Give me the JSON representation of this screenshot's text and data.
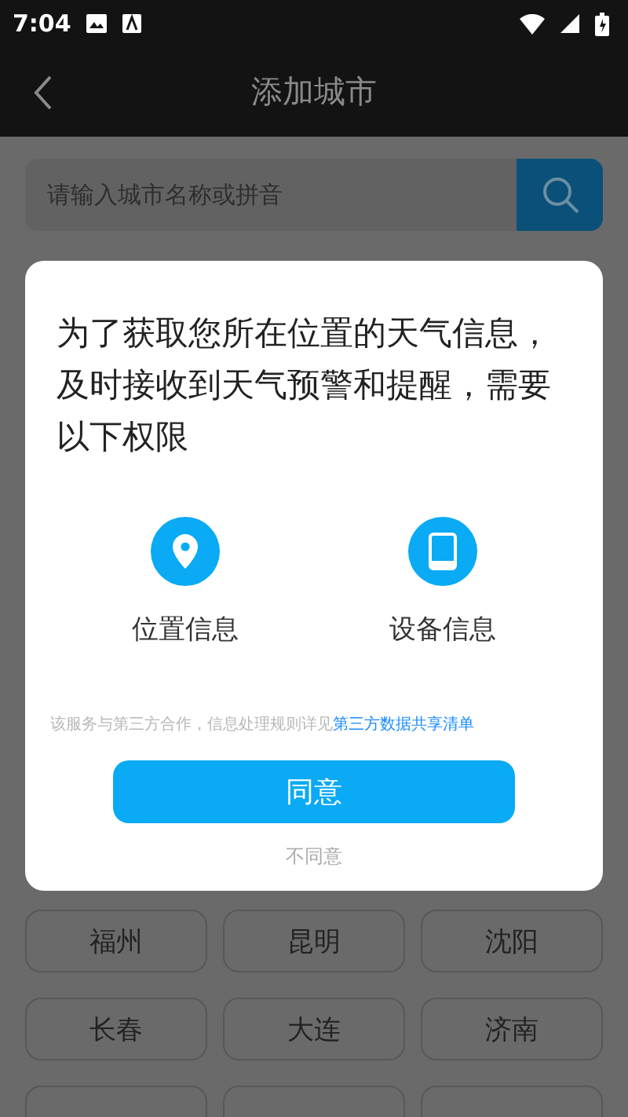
{
  "status_bar": {
    "time": "7:04"
  },
  "app_bar": {
    "title": "添加城市"
  },
  "search": {
    "placeholder": "请输入城市名称或拼音"
  },
  "dialog": {
    "message": "为了获取您所在位置的天气信息，及时接收到天气预警和提醒，需要以下权限",
    "permissions": [
      {
        "kind": "location",
        "label": "位置信息"
      },
      {
        "kind": "device",
        "label": "设备信息"
      }
    ],
    "note": "该服务与第三方合作，信息处理规则详见",
    "note_link": "第三方数据共享清单",
    "agree": "同意",
    "disagree": "不同意"
  },
  "cities": [
    [
      "福州",
      "昆明",
      "沈阳"
    ],
    [
      "长春",
      "大连",
      "济南"
    ]
  ]
}
